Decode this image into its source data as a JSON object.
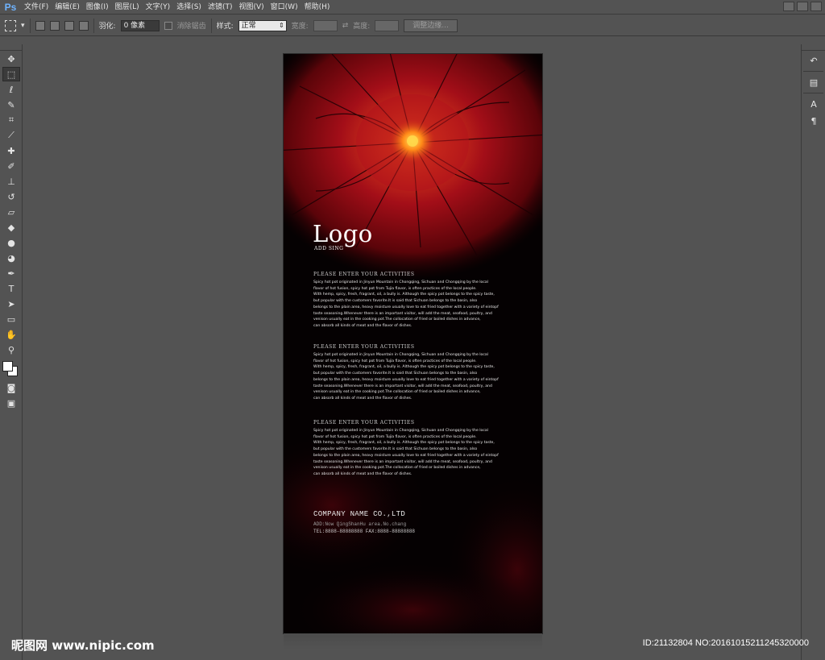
{
  "app": {
    "logo_text": "Ps"
  },
  "menu": [
    "文件(F)",
    "编辑(E)",
    "图像(I)",
    "图层(L)",
    "文字(Y)",
    "选择(S)",
    "滤镜(T)",
    "视图(V)",
    "窗口(W)",
    "帮助(H)"
  ],
  "options": {
    "feather_label": "羽化:",
    "feather_value": "0 像素",
    "antialias_label": "消除锯齿",
    "style_label": "样式:",
    "style_value": "正常",
    "width_label": "宽度:",
    "height_label": "高度:",
    "refine_edge_label": "调整边缘..."
  },
  "tools": [
    "marquee-icon",
    "lasso-icon",
    "quick-select-icon",
    "crop-icon",
    "eyedropper-icon",
    "healing-icon",
    "brush-icon",
    "stamp-icon",
    "history-brush-icon",
    "eraser-icon",
    "paint-bucket-icon",
    "blur-icon",
    "dodge-icon",
    "pen-icon",
    "type-icon",
    "path-select-icon",
    "shape-icon",
    "hand-icon",
    "zoom-icon"
  ],
  "colors": {
    "foreground": "#ffffff",
    "background": "#ffffff",
    "ui_bg": "#535353",
    "accent_red": "#b0121c"
  },
  "document": {
    "logo": "Logo",
    "logo_sub": "ADD SING",
    "sections": [
      {
        "heading": "PLEASE ENTER YOUR ACTIVITIES",
        "lines": [
          "Spicy hot pot originated in Jinyun Mountain in Chongqing, Sichuan and Chongqing by the local",
          "flavor of hot fusion, spicy hot pot from Tujia flavor, is often practices of the local people.",
          "With hemp, spicy, fresh, fragrant, oil, a bully is. Although the spicy pot belongs to the spicy taste,",
          "but popular with the customers favorite.It is said that Sichuan belongs to the basin, also",
          "belongs to the plain area, heavy moisture usually love to eat fried together with a variety of eintopf",
          "taste seasoning.Whenever there is an important visitor, will add the meat, seafood, poultry, and",
          "venison usually eat in the cooking pot.The collocation of fried or boiled dishes in advance,",
          "can absorb all kinds of meat and the flavor of dishes."
        ]
      },
      {
        "heading": "PLEASE ENTER YOUR ACTIVITIES",
        "lines": [
          "Spicy hot pot originated in Jinyun Mountain in Chongqing, Sichuan and Chongqing by the local",
          "flavor of hot fusion, spicy hot pot from Tujia flavor, is often practices of the local people.",
          "With hemp, spicy, fresh, fragrant, oil, a bully is. Although the spicy pot belongs to the spicy taste,",
          "but popular with the customers favorite.It is said that Sichuan belongs to the basin, also",
          "belongs to the plain area, heavy moisture usually love to eat fried together with a variety of eintopf",
          "taste seasoning.Whenever there is an important visitor, will add the meat, seafood, poultry, and",
          "venison usually eat in the cooking pot.The collocation of fried or boiled dishes in advance,",
          "can absorb all kinds of meat and the flavor of dishes."
        ]
      },
      {
        "heading": "PLEASE ENTER YOUR ACTIVITIES",
        "lines": [
          "Spicy hot pot originated in Jinyun Mountain in Chongqing, Sichuan and Chongqing by the local",
          "flavor of hot fusion, spicy hot pot from Tujia flavor, is often practices of the local people.",
          "With hemp, spicy, fresh, fragrant, oil, a bully is. Although the spicy pot belongs to the spicy taste,",
          "but popular with the customers favorite.It is said that Sichuan belongs to the basin, also",
          "belongs to the plain area, heavy moisture usually love to eat fried together with a variety of eintopf",
          "taste seasoning.Whenever there is an important visitor, will add the meat, seafood, poultry, and",
          "venison usually eat in the cooking pot.The collocation of fried or boiled dishes in advance,",
          "can absorb all kinds of meat and the flavor of dishes."
        ]
      }
    ],
    "company": "COMPANY NAME CO.,LTD",
    "address": "ADD:Now QingShanHu area.No.chang",
    "tel": "TEL:8888-88888888  FAX:8888-88888888"
  },
  "watermark": {
    "left": "昵图网 www.nipic.com",
    "right": "ID:21132804 NO:20161015211245320000"
  }
}
